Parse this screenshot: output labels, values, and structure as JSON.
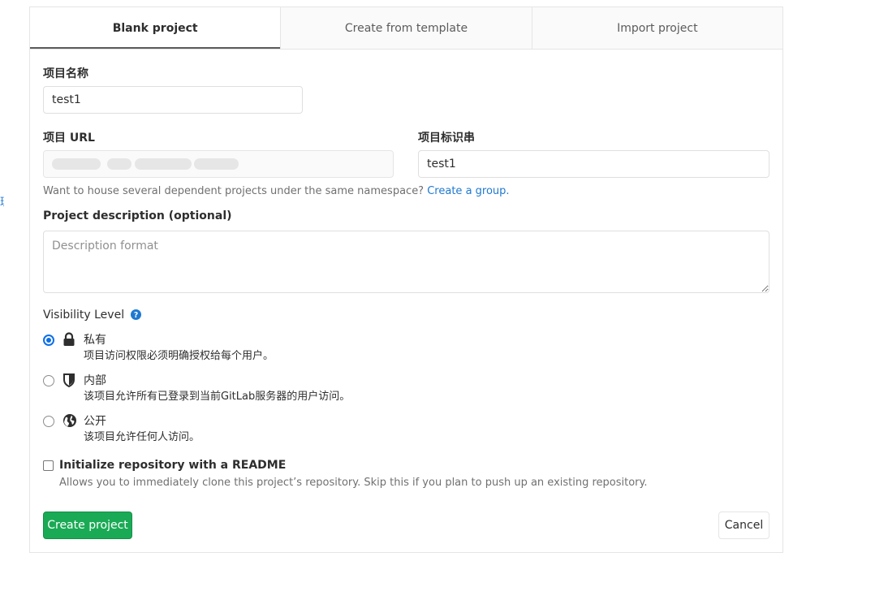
{
  "edge_link": "理",
  "tabs": [
    {
      "label": "Blank project",
      "active": true
    },
    {
      "label": "Create from template",
      "active": false
    },
    {
      "label": "Import project",
      "active": false
    }
  ],
  "form": {
    "project_name_label": "项目名称",
    "project_name_value": "test1",
    "project_url_label": "项目 URL",
    "project_slug_label": "项目标识串",
    "project_slug_value": "test1",
    "namespace_help": "Want to house several dependent projects under the same namespace?",
    "create_group_link": "Create a group.",
    "description_label": "Project description (optional)",
    "description_placeholder": "Description format",
    "visibility_label": "Visibility Level",
    "visibility_options": [
      {
        "title": "私有",
        "description": "项目访问权限必须明确授权给每个用户。",
        "icon": "lock-icon",
        "checked": true
      },
      {
        "title": "内部",
        "description": "该项目允许所有已登录到当前GitLab服务器的用户访问。",
        "icon": "shield-icon",
        "checked": false
      },
      {
        "title": "公开",
        "description": "该项目允许任何人访问。",
        "icon": "globe-icon",
        "checked": false
      }
    ],
    "readme_label": "Initialize repository with a README",
    "readme_help": "Allows you to immediately clone this project’s repository. Skip this if you plan to push up an existing repository.",
    "readme_checked": false
  },
  "buttons": {
    "create": "Create project",
    "cancel": "Cancel"
  },
  "colors": {
    "accent": "#1f78d1",
    "success": "#1aaa55",
    "radio_checked": "#0b6fe8"
  }
}
